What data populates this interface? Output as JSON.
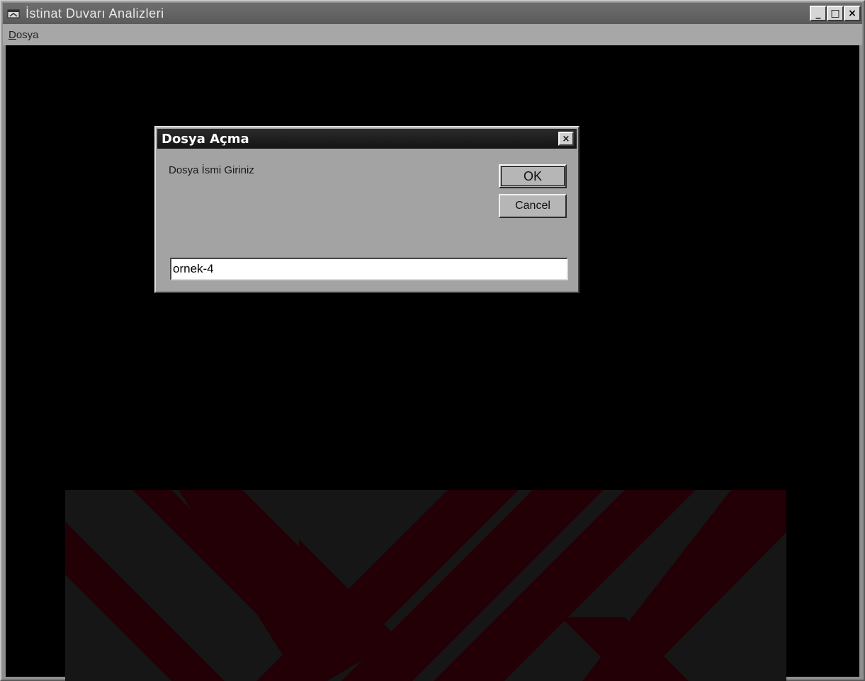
{
  "window": {
    "title": "İstinat Duvarı Analizleri",
    "buttons": {
      "minimize": "_",
      "maximize": "□",
      "close": "×"
    }
  },
  "menu": {
    "items": [
      {
        "label": "Dosya",
        "mnemonic": "D"
      }
    ]
  },
  "dialog": {
    "title": "Dosya Açma",
    "close_glyph": "×",
    "prompt": "Dosya İsmi Giriniz",
    "ok_label": "OK",
    "cancel_label": "Cancel",
    "input_value": "ornek-4"
  },
  "icons": [
    "app-window-icon",
    "close-icon"
  ],
  "colors": {
    "client_background": "#000000",
    "dialog_title_bar": "#141414",
    "backdrop_stripe": "#2a0006"
  }
}
